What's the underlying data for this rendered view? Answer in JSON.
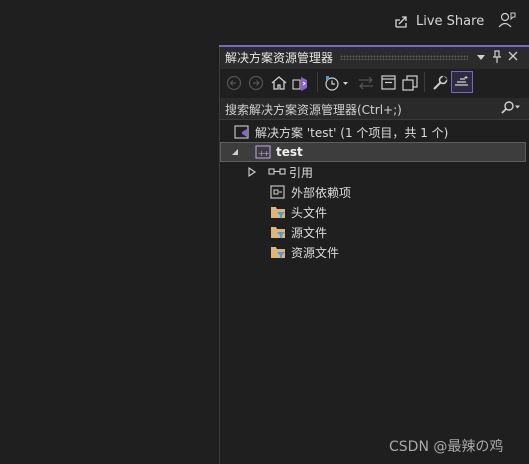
{
  "topbar": {
    "live_share_label": "Live Share",
    "live_share_icon": "live-share-icon",
    "feedback_icon": "feedback-person-icon"
  },
  "panel": {
    "title": "解决方案资源管理器",
    "accent_color": "#7a66c9",
    "window_controls": [
      "dropdown-icon",
      "pin-icon",
      "close-icon"
    ]
  },
  "toolbar": {
    "buttons": [
      "back-icon",
      "forward-icon",
      "home-icon",
      "switch-views-icon",
      "pending-changes-icon",
      "sync-icon",
      "collapse-all-icon",
      "show-all-files-icon",
      "properties-icon",
      "preview-selected-icon"
    ]
  },
  "search": {
    "placeholder": "搜索解决方案资源管理器(Ctrl+;)"
  },
  "tree": {
    "solution": "解决方案 'test' (1 个项目，共 1 个)",
    "project": "test",
    "items": [
      {
        "label": "引用",
        "icon": "references-icon"
      },
      {
        "label": "外部依赖项",
        "icon": "external-dependencies-icon"
      },
      {
        "label": "头文件",
        "icon": "filter-folder-icon"
      },
      {
        "label": "源文件",
        "icon": "filter-folder-icon"
      },
      {
        "label": "资源文件",
        "icon": "filter-folder-icon"
      }
    ]
  },
  "watermark": "CSDN @最辣の鸡"
}
